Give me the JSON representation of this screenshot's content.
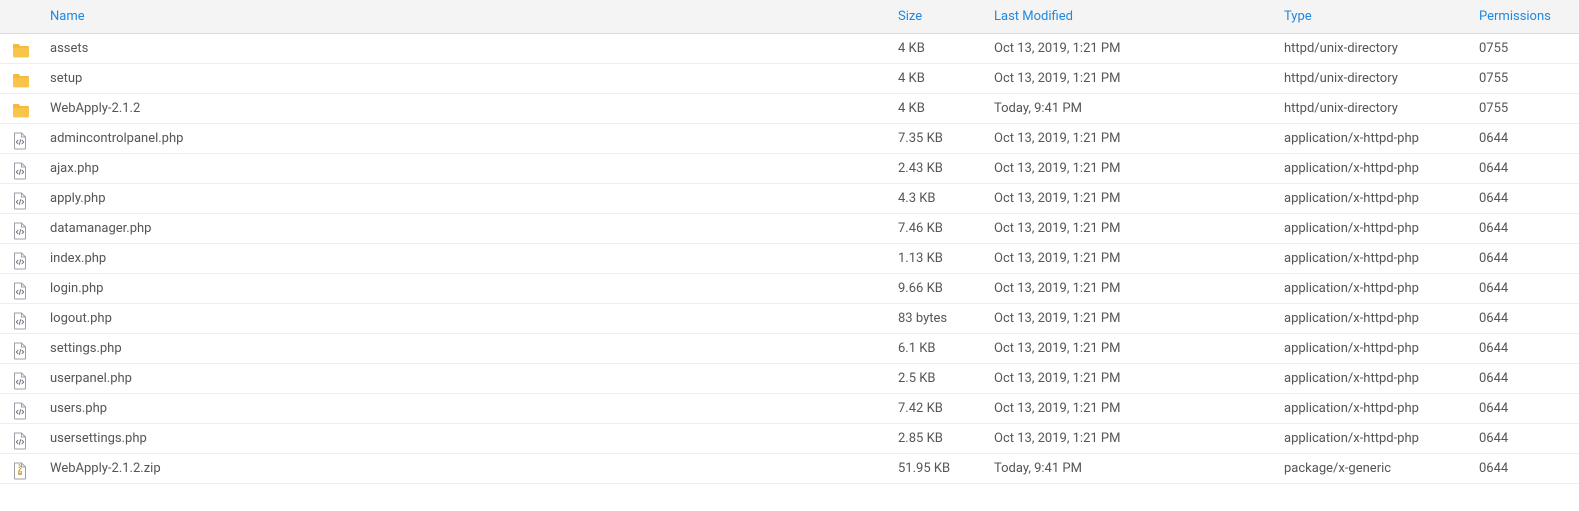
{
  "columns": {
    "name": "Name",
    "size": "Size",
    "modified": "Last Modified",
    "type": "Type",
    "permissions": "Permissions"
  },
  "icons": {
    "folder": "folder",
    "php": "code-file",
    "archive": "archive-file"
  },
  "rows": [
    {
      "icon": "folder",
      "name": "assets",
      "size": "4 KB",
      "modified": "Oct 13, 2019, 1:21 PM",
      "type": "httpd/unix-directory",
      "perm": "0755"
    },
    {
      "icon": "folder",
      "name": "setup",
      "size": "4 KB",
      "modified": "Oct 13, 2019, 1:21 PM",
      "type": "httpd/unix-directory",
      "perm": "0755"
    },
    {
      "icon": "folder",
      "name": "WebApply-2.1.2",
      "size": "4 KB",
      "modified": "Today, 9:41 PM",
      "type": "httpd/unix-directory",
      "perm": "0755"
    },
    {
      "icon": "php",
      "name": "admincontrolpanel.php",
      "size": "7.35 KB",
      "modified": "Oct 13, 2019, 1:21 PM",
      "type": "application/x-httpd-php",
      "perm": "0644"
    },
    {
      "icon": "php",
      "name": "ajax.php",
      "size": "2.43 KB",
      "modified": "Oct 13, 2019, 1:21 PM",
      "type": "application/x-httpd-php",
      "perm": "0644"
    },
    {
      "icon": "php",
      "name": "apply.php",
      "size": "4.3 KB",
      "modified": "Oct 13, 2019, 1:21 PM",
      "type": "application/x-httpd-php",
      "perm": "0644"
    },
    {
      "icon": "php",
      "name": "datamanager.php",
      "size": "7.46 KB",
      "modified": "Oct 13, 2019, 1:21 PM",
      "type": "application/x-httpd-php",
      "perm": "0644"
    },
    {
      "icon": "php",
      "name": "index.php",
      "size": "1.13 KB",
      "modified": "Oct 13, 2019, 1:21 PM",
      "type": "application/x-httpd-php",
      "perm": "0644"
    },
    {
      "icon": "php",
      "name": "login.php",
      "size": "9.66 KB",
      "modified": "Oct 13, 2019, 1:21 PM",
      "type": "application/x-httpd-php",
      "perm": "0644"
    },
    {
      "icon": "php",
      "name": "logout.php",
      "size": "83 bytes",
      "modified": "Oct 13, 2019, 1:21 PM",
      "type": "application/x-httpd-php",
      "perm": "0644"
    },
    {
      "icon": "php",
      "name": "settings.php",
      "size": "6.1 KB",
      "modified": "Oct 13, 2019, 1:21 PM",
      "type": "application/x-httpd-php",
      "perm": "0644"
    },
    {
      "icon": "php",
      "name": "userpanel.php",
      "size": "2.5 KB",
      "modified": "Oct 13, 2019, 1:21 PM",
      "type": "application/x-httpd-php",
      "perm": "0644"
    },
    {
      "icon": "php",
      "name": "users.php",
      "size": "7.42 KB",
      "modified": "Oct 13, 2019, 1:21 PM",
      "type": "application/x-httpd-php",
      "perm": "0644"
    },
    {
      "icon": "php",
      "name": "usersettings.php",
      "size": "2.85 KB",
      "modified": "Oct 13, 2019, 1:21 PM",
      "type": "application/x-httpd-php",
      "perm": "0644"
    },
    {
      "icon": "archive",
      "name": "WebApply-2.1.2.zip",
      "size": "51.95 KB",
      "modified": "Today, 9:41 PM",
      "type": "package/x-generic",
      "perm": "0644"
    }
  ]
}
